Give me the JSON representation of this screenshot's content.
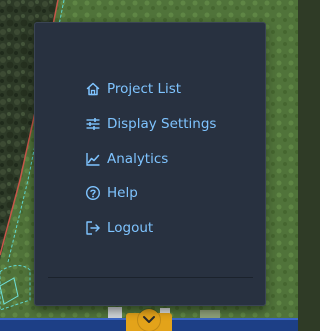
{
  "menu": {
    "items": [
      {
        "label": "Project List",
        "icon": "home-icon"
      },
      {
        "label": "Display Settings",
        "icon": "sliders-icon"
      },
      {
        "label": "Analytics",
        "icon": "chart-line-icon"
      },
      {
        "label": "Help",
        "icon": "help-circle-icon"
      },
      {
        "label": "Logout",
        "icon": "logout-icon"
      }
    ]
  },
  "colors": {
    "panel_bg": "#283140",
    "item_text": "#7fc4ff",
    "toggle": "#e3a31a",
    "bottom_bar": "#1d3f86"
  }
}
